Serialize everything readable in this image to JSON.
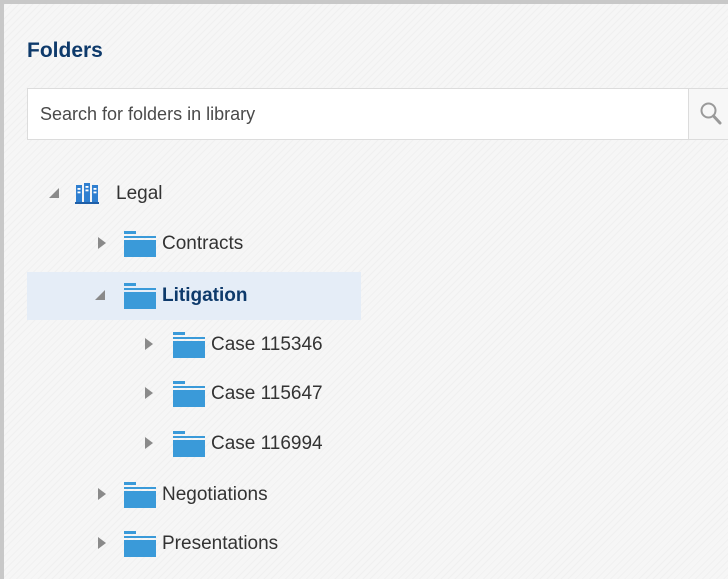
{
  "panel": {
    "title": "Folders"
  },
  "search": {
    "placeholder": "Search for folders in library"
  },
  "tree": {
    "library": {
      "label": "Legal",
      "expanded": true,
      "icon": "library-icon"
    },
    "items": [
      {
        "label": "Contracts",
        "expanded": false,
        "selected": false,
        "icon": "folder-icon"
      },
      {
        "label": "Litigation",
        "expanded": true,
        "selected": true,
        "icon": "folder-icon"
      },
      {
        "label": "Case 115346",
        "expanded": false,
        "selected": false,
        "icon": "folder-icon"
      },
      {
        "label": "Case 115647",
        "expanded": false,
        "selected": false,
        "icon": "folder-icon"
      },
      {
        "label": "Case 116994",
        "expanded": false,
        "selected": false,
        "icon": "folder-icon"
      },
      {
        "label": "Negotiations",
        "expanded": false,
        "selected": false,
        "icon": "folder-icon"
      },
      {
        "label": "Presentations",
        "expanded": false,
        "selected": false,
        "icon": "folder-icon"
      }
    ]
  },
  "colors": {
    "title": "#0e3a6b",
    "folder": "#3a9ad9",
    "selection": "#e5edf7",
    "twisty": "#8a8a8a"
  }
}
